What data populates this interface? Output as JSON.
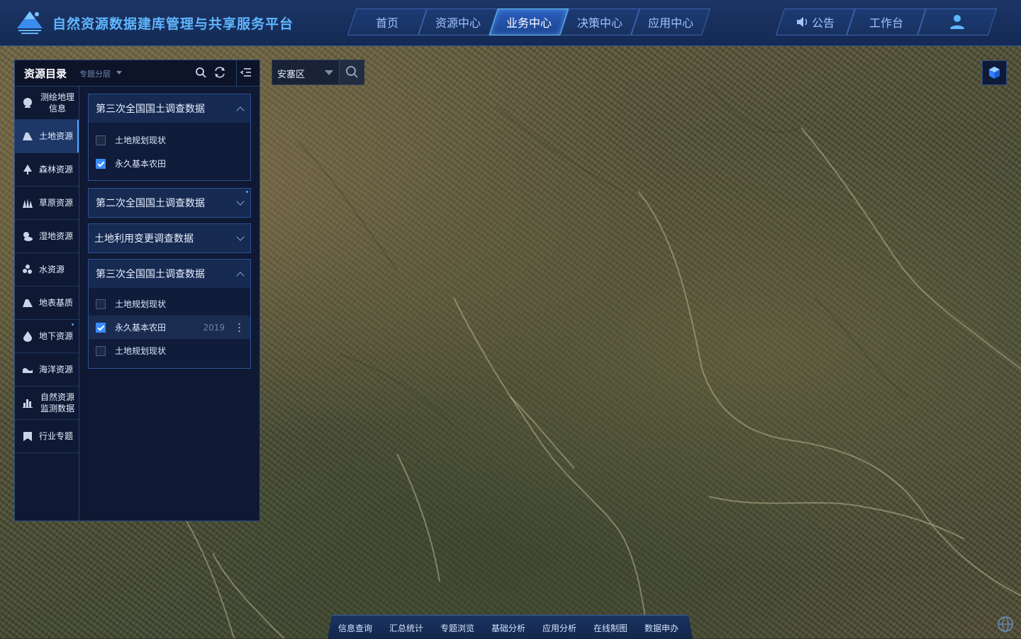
{
  "header": {
    "app_title": "自然资源数据建库管理与共享服务平台",
    "nav": [
      "首页",
      "资源中心",
      "业务中心",
      "决策中心",
      "应用中心"
    ],
    "active_nav": "业务中心",
    "announcement_label": "公告",
    "workbench_label": "工作台"
  },
  "panel": {
    "title": "资源目录",
    "layer_mode": "专题分层",
    "categories": [
      {
        "label": "测绘地理信息",
        "icon": "globe-icon"
      },
      {
        "label": "土地资源",
        "icon": "land-icon"
      },
      {
        "label": "森林资源",
        "icon": "tree-icon"
      },
      {
        "label": "草原资源",
        "icon": "grass-icon"
      },
      {
        "label": "湿地资源",
        "icon": "wetland-icon"
      },
      {
        "label": "水资源",
        "icon": "water-icon"
      },
      {
        "label": "地表基质",
        "icon": "surface-icon"
      },
      {
        "label": "地下资源",
        "icon": "underground-icon"
      },
      {
        "label": "海洋资源",
        "icon": "ocean-icon"
      },
      {
        "label": "自然资源监测数据",
        "icon": "bar-chart-icon"
      },
      {
        "label": "行业专题",
        "icon": "bookmark-icon"
      }
    ],
    "active_category": "土地资源",
    "groups": [
      {
        "title": "第三次全国国土调查数据",
        "expanded": true,
        "items": [
          {
            "label": "土地规划现状",
            "checked": false
          },
          {
            "label": "永久基本农田",
            "checked": true
          }
        ]
      },
      {
        "title": "第二次全国国土调查数据",
        "expanded": false,
        "items": []
      },
      {
        "title": "土地利用变更调查数据",
        "expanded": false,
        "items": []
      },
      {
        "title": "第三次全国国土调查数据",
        "expanded": true,
        "items": [
          {
            "label": "土地规划现状",
            "checked": false
          },
          {
            "label": "永久基本农田",
            "checked": true,
            "year": "2019"
          },
          {
            "label": "土地规划现状",
            "checked": false
          }
        ]
      }
    ]
  },
  "search": {
    "region": "安塞区"
  },
  "toolbar": [
    "信息查询",
    "汇总统计",
    "专题浏览",
    "基础分析",
    "应用分析",
    "在线制图",
    "数据申办"
  ],
  "colors": {
    "accent": "#3a8bff",
    "title": "#5fb6ff",
    "header_bg": "#1d3566"
  }
}
